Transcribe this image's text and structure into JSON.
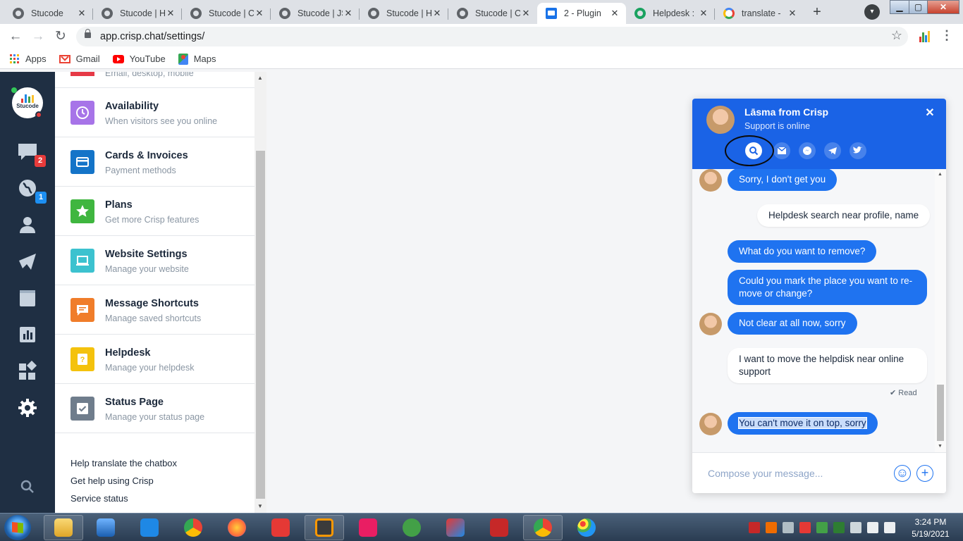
{
  "browser": {
    "tabs": [
      {
        "title": "Stucode",
        "icon": "globe-icon"
      },
      {
        "title": "Stucode | H",
        "icon": "globe-icon"
      },
      {
        "title": "Stucode | C",
        "icon": "globe-icon"
      },
      {
        "title": "Stucode | JS",
        "icon": "globe-icon"
      },
      {
        "title": "Stucode | H",
        "icon": "globe-icon"
      },
      {
        "title": "Stucode | C",
        "icon": "globe-icon"
      },
      {
        "title": "2 - Plugin",
        "icon": "plugins-icon",
        "active": true
      },
      {
        "title": "Helpdesk : ",
        "icon": "helpdesk-icon"
      },
      {
        "title": "translate - ",
        "icon": "google-icon"
      }
    ],
    "tab_close_glyph": "✕",
    "new_tab_glyph": "+",
    "url": "app.crisp.chat/settings/",
    "bookmarks": [
      {
        "label": "Apps",
        "icon": "apps-grid-icon"
      },
      {
        "label": "Gmail",
        "icon": "gmail-icon"
      },
      {
        "label": "YouTube",
        "icon": "youtube-icon"
      },
      {
        "label": "Maps",
        "icon": "maps-icon"
      }
    ]
  },
  "rail": {
    "logo_text": "Stucode",
    "conversations_badge": "2",
    "visitors_badge": "1",
    "icons": [
      "chat-icon",
      "globe-icon",
      "contacts-icon",
      "campaigns-icon",
      "helpdesk-book-icon",
      "analytics-icon",
      "plugins-icon",
      "settings-gear-icon",
      "search-icon"
    ]
  },
  "settings": {
    "partial_desc": "Email, desktop, mobile",
    "items": [
      {
        "name": "Availability",
        "desc": "When visitors see you online",
        "color": "#a774e8",
        "icon": "clock-icon"
      },
      {
        "name": "Cards & Invoices",
        "desc": "Payment methods",
        "color": "#1474c8",
        "icon": "card-icon"
      },
      {
        "name": "Plans",
        "desc": "Get more Crisp features",
        "color": "#3fb63f",
        "icon": "star-icon"
      },
      {
        "name": "Website Settings",
        "desc": "Manage your website",
        "color": "#3cc2cf",
        "icon": "laptop-icon"
      },
      {
        "name": "Message Shortcuts",
        "desc": "Manage saved shortcuts",
        "color": "#f07d2a",
        "icon": "shortcut-icon"
      },
      {
        "name": "Helpdesk",
        "desc": "Manage your helpdesk",
        "color": "#f4c20d",
        "icon": "helpdesk-icon"
      },
      {
        "name": "Status Page",
        "desc": "Manage your status page",
        "color": "#6f7d8c",
        "icon": "status-check-icon"
      }
    ],
    "links": [
      "Help translate the chatbox",
      "Get help using Crisp",
      "Service status"
    ]
  },
  "chat": {
    "agent_name": "Lāsma from Crisp",
    "status": "Support is online",
    "close_glyph": "✕",
    "channels": [
      "search-icon",
      "email-icon",
      "messenger-icon",
      "telegram-icon",
      "twitter-icon"
    ],
    "messages": [
      {
        "from": "operator",
        "text": "Sorry, I don't get you"
      },
      {
        "from": "user",
        "text": "Helpdesk search near profile, name"
      },
      {
        "from": "operator",
        "text": "What do you want to remove?"
      },
      {
        "from": "operator",
        "text": "Could you mark the place you want to re-move or change?"
      },
      {
        "from": "operator",
        "text": "Not clear at all now, sorry"
      },
      {
        "from": "user",
        "text": "I want to move the helpdisk near online support"
      },
      {
        "from": "operator",
        "text": "You can't move it on top, sorry"
      }
    ],
    "read_label": "✔ Read",
    "compose_placeholder": "Compose your message...",
    "accent": "#1a63e6"
  },
  "taskbar": {
    "time": "3:24 PM",
    "date": "5/19/2021"
  }
}
